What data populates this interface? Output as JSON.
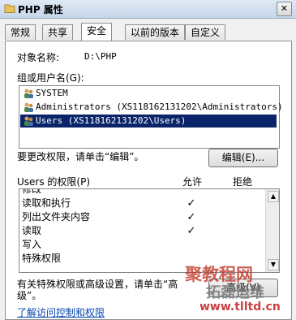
{
  "window": {
    "title": "PHP 属性",
    "close_glyph": "✕"
  },
  "tabs": [
    {
      "label": "常规"
    },
    {
      "label": "共享"
    },
    {
      "label": "安全",
      "active": true
    },
    {
      "label": "以前的版本"
    },
    {
      "label": "自定义"
    }
  ],
  "security": {
    "object_name_label": "对象名称:",
    "object_name_value": "D:\\PHP",
    "groups_label": "组或用户名(G):",
    "groups": [
      {
        "name": "SYSTEM",
        "icon": "users-icon"
      },
      {
        "name": "Administrators (XS118162131202\\Administrators)",
        "icon": "users-icon"
      },
      {
        "name": "Users (XS118162131202\\Users)",
        "icon": "users-icon",
        "selected": true
      }
    ],
    "change_hint": "要更改权限，请单击“编辑”。",
    "edit_button": "编辑(E)...",
    "permissions_for": "Users 的权限(P)",
    "allow_header": "允许",
    "deny_header": "拒绝",
    "permissions": [
      {
        "name": "修改",
        "allow": false
      },
      {
        "name": "读取和执行",
        "allow": true,
        "mark": "✓"
      },
      {
        "name": "列出文件夹内容",
        "allow": true,
        "mark": "✓"
      },
      {
        "name": "读取",
        "allow": true,
        "mark": "✓"
      },
      {
        "name": "写入",
        "allow": false
      },
      {
        "name": "特殊权限",
        "allow": false
      }
    ],
    "special_hint_line1": "有关特殊权限或高级设置，请单击“高",
    "special_hint_line2": "级”。",
    "advanced_button": "高级(V)",
    "learn_link": "了解访问控制和权限"
  },
  "watermark": {
    "line1": "聚教程网",
    "line2": "拓磊运维",
    "line3": "www.tlltd.cn"
  }
}
